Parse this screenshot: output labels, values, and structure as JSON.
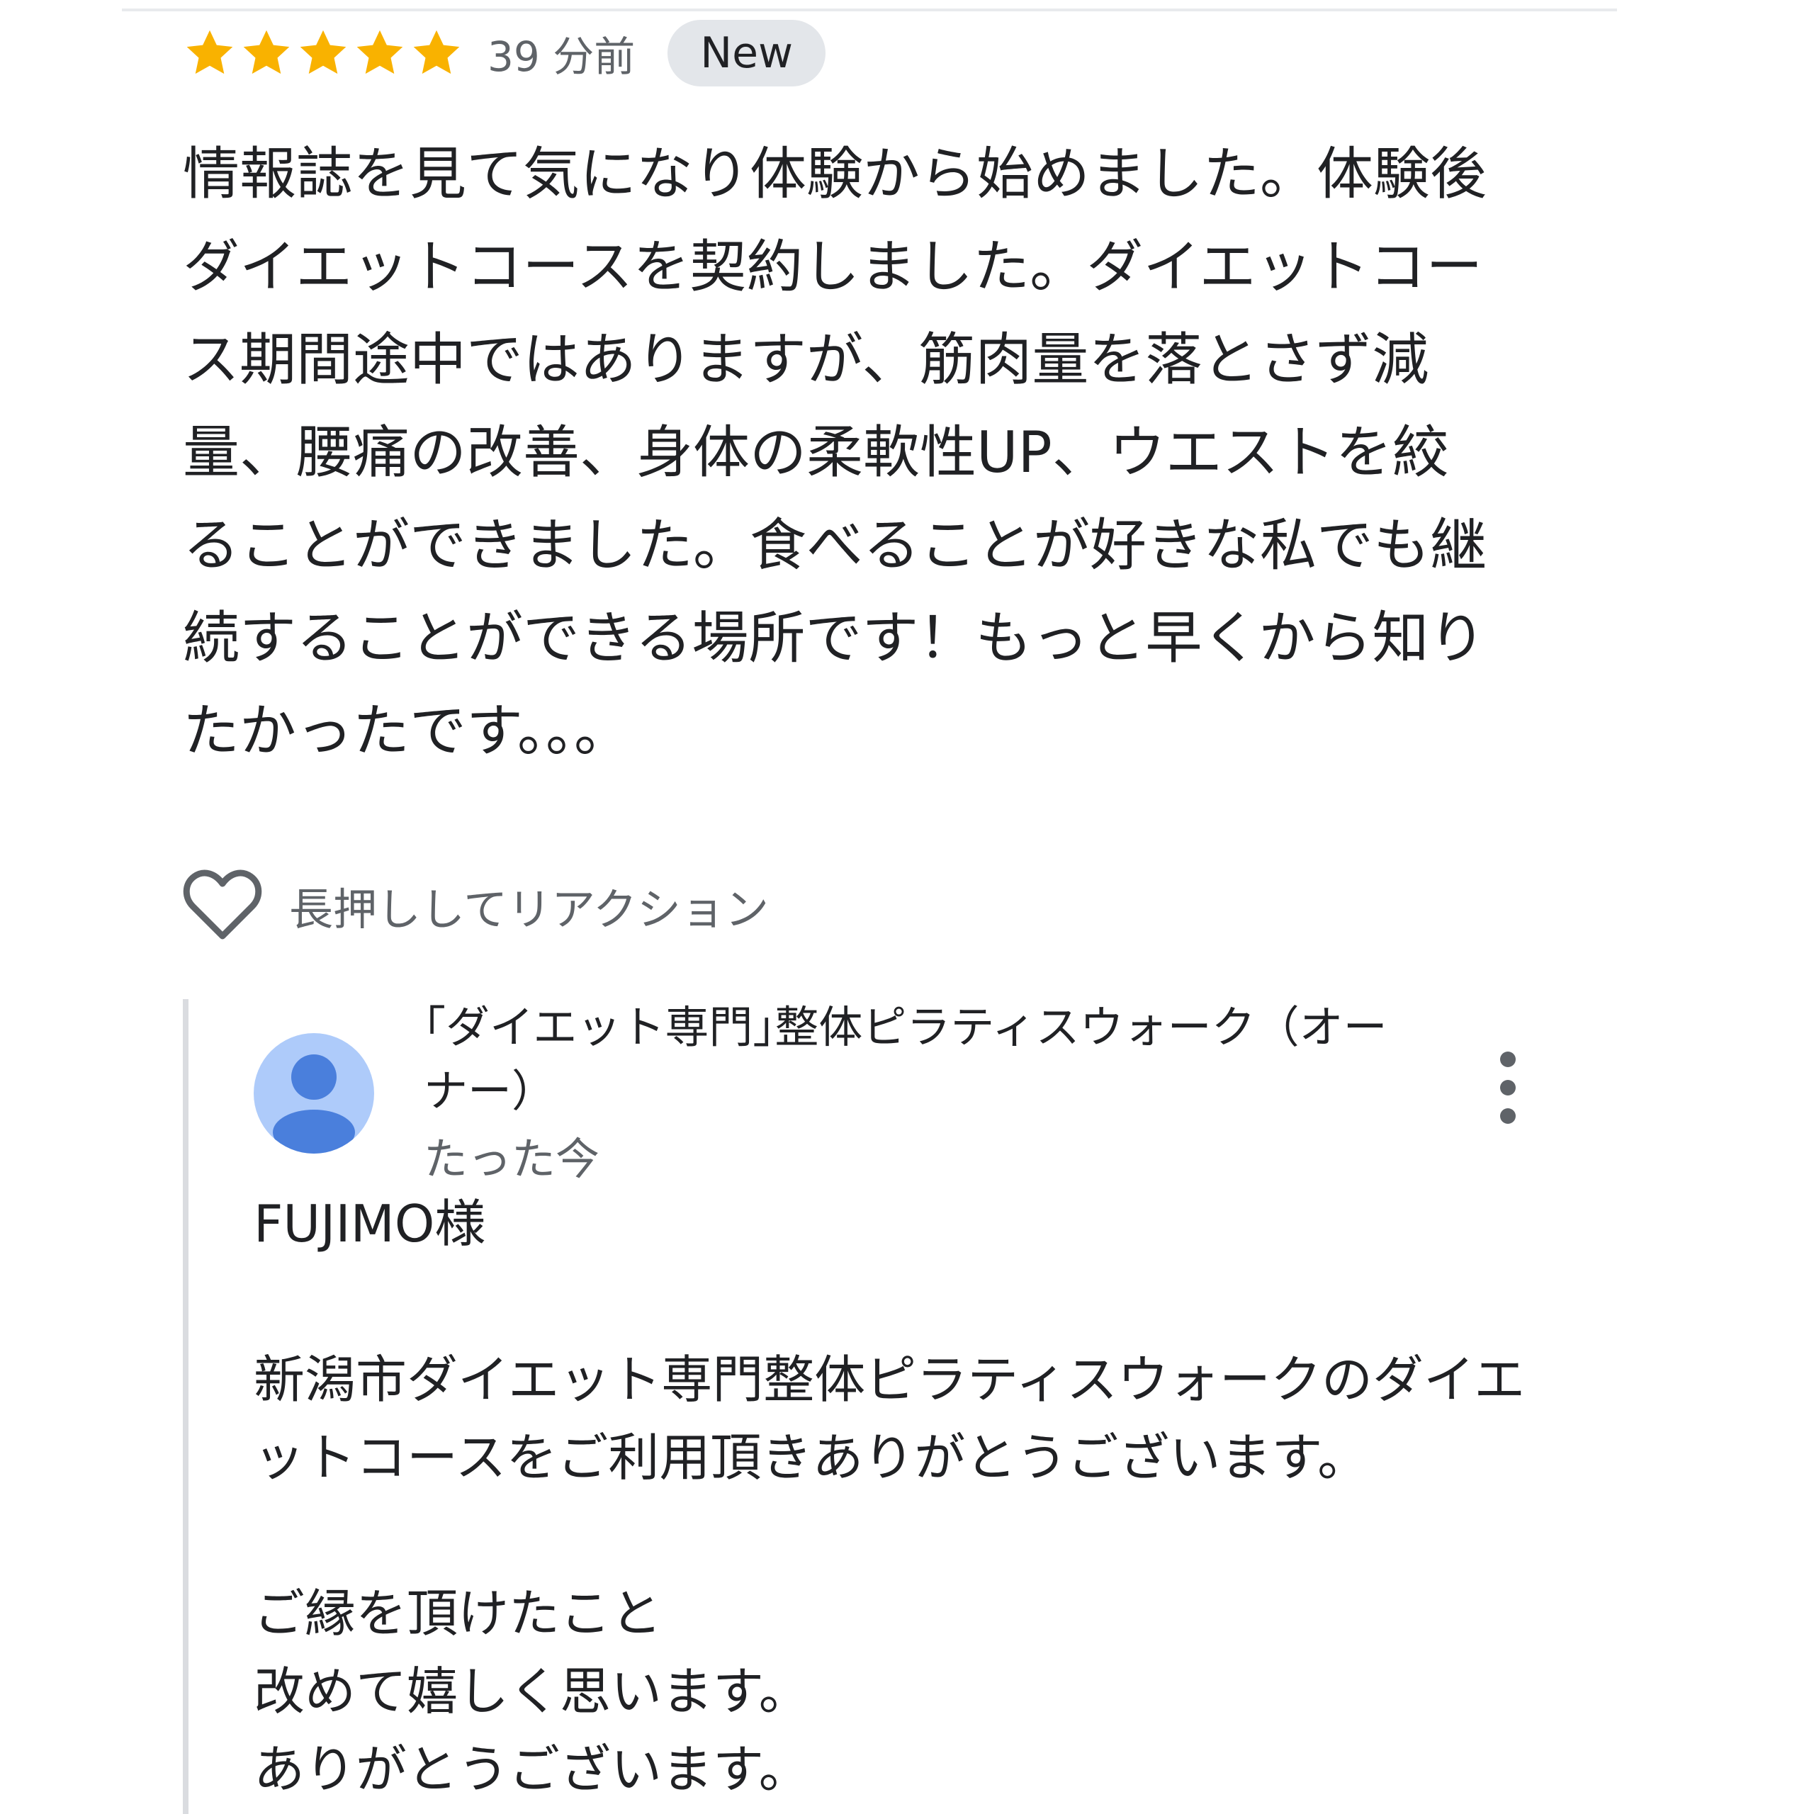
{
  "review": {
    "rating": 5,
    "time_ago": "39 分前",
    "badge": "New",
    "text": "情報誌を見て気になり体験から始めました。体験後\nダイエットコースを契約しました。ダイエットコー\nス期間途中ではありますが、筋肉量を落とさず減\n量、腰痛の改善、身体の柔軟性UP、ウエストを絞\nることができました。食べることが好きな私でも継\n続することができる場所です！もっと早くから知り\nたかったです。。。"
  },
  "reaction": {
    "label": "長押ししてリアクション",
    "icon": "heart-outline-icon"
  },
  "owner_reply": {
    "name": "｢ダイエット専門｣整体ピラティスウォーク（オーナー）",
    "time": "たった今",
    "avatar_icon": "person-icon",
    "menu_icon": "more-vert-icon",
    "text": "FUJIMO様\n\n新潟市ダイエット専門整体ピラティスウォークのダイエ\nットコースをご利用頂きありがとうございます。\n\nご縁を頂けたこと\n改めて嬉しく思います。\nありがとうございます。"
  },
  "colors": {
    "star": "#f9b200",
    "badge_bg": "#e3e6ea",
    "avatar_bg": "#aecbfa",
    "avatar_fg": "#4a7fdc",
    "secondary_text": "#5f6368"
  }
}
